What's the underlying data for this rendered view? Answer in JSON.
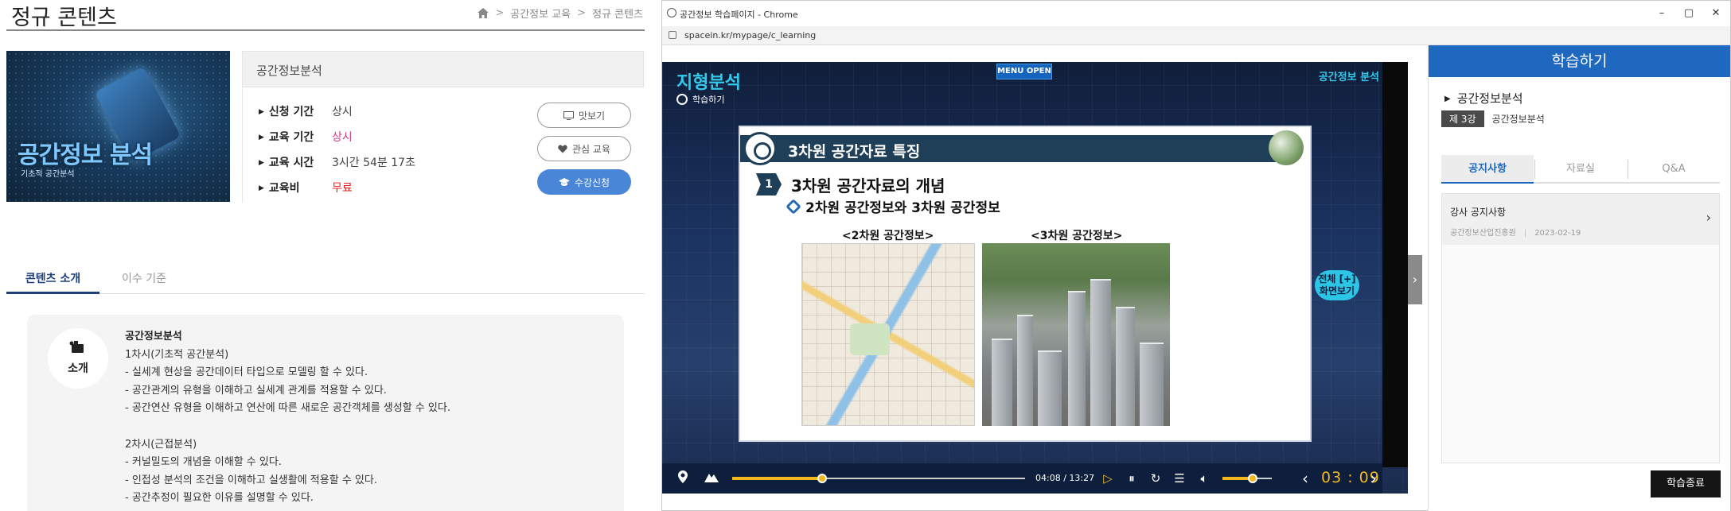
{
  "left": {
    "page_title": "정규 콘텐츠",
    "breadcrumb": [
      "공간정보 교육",
      "정규 콘텐츠"
    ],
    "thumbnail": {
      "title": "공간정보 분석",
      "subtitle": "기초적 공간분석"
    },
    "course_name": "공간정보분석",
    "info": [
      {
        "label": "신청 기간",
        "value": "상시"
      },
      {
        "label": "교육 기간",
        "value": "상시"
      },
      {
        "label": "교육 시간",
        "value": "3시간 54분 17초"
      },
      {
        "label": "교육비",
        "value": "무료"
      }
    ],
    "buttons": {
      "preview": "맛보기",
      "interest": "관심 교육",
      "enroll": "수강신청"
    },
    "tabs": [
      "콘텐츠 소개",
      "이수 기준"
    ],
    "intro_icon_label": "소개",
    "intro": {
      "title": "공간정보분석",
      "lines": [
        "1차시(기초적 공간분석)",
        " - 실세계 현상을 공간데이터 타입으로 모델링 할 수 있다.",
        " - 공간관계의 유형을 이해하고 실세계 관계를 적용할 수 있다.",
        " - 공간연산 유형을 이해하고 연산에 따른 새로운 공간객체를 생성할 수 있다.",
        "",
        "2차시(근접분석)",
        " - 커널밀도의 개념을 이해할 수 있다.",
        " - 인접성 분석의 조건을 이해하고 실생활에 적용할 수 있다.",
        " - 공간추정이 필요한 이유를 설명할 수 있다."
      ]
    }
  },
  "window": {
    "title": "공간정보 학습페이지 - Chrome",
    "url": "spacein.kr/mypage/c_learning",
    "controls": [
      "minimize",
      "maximize",
      "close"
    ]
  },
  "player": {
    "title": "지형분석",
    "subtitle": "학습하기",
    "menu_open": "MENU OPEN",
    "brand": "공간정보 분석",
    "slide": {
      "header": "3차원 공간자료 특징",
      "num": "1",
      "heading": "3차원 공간자료의 개념",
      "subheading": "2차원 공간정보와 3차원 공간정보",
      "label_2d": "<2차원 공간정보>",
      "label_3d": "<3차원 공간정보>"
    },
    "fullscreen_label_1": "전체 [+]",
    "fullscreen_label_2": "화면보기",
    "time": "04:08 / 13:27",
    "progress": 0.308,
    "volume": 0.62,
    "countdown": "03 : 09",
    "icons": [
      "location-icon",
      "mountain-icon",
      "play-icon",
      "pause-icon",
      "replay-icon",
      "list-icon",
      "volume-icon",
      "prev-icon",
      "next-icon"
    ]
  },
  "panel": {
    "title": "학습하기",
    "course": "공간정보분석",
    "episode_tag": "제 3강",
    "episode_name": "공간정보분석",
    "tabs": [
      "공지사항",
      "자료실",
      "Q&A"
    ],
    "notice": {
      "title": "강사 공지사항",
      "author": "공간정보산업진흥원",
      "date": "2023-02-19"
    },
    "end_button": "학습종료"
  },
  "colors": {
    "accent_blue": "#1e69bf",
    "enroll_blue": "#4a86d8",
    "player_cyan": "#33c9ea",
    "highlight_yellow": "#f4b81f",
    "pink": "#d23a8b",
    "red": "#e02020"
  }
}
